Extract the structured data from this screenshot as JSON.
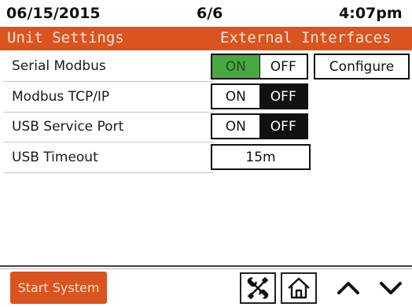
{
  "status": {
    "date": "06/15/2015",
    "page": "6/6",
    "time": "4:07pm"
  },
  "title": {
    "left": "Unit Settings",
    "right": "External Interfaces"
  },
  "rows": [
    {
      "label": "Serial Modbus",
      "on": "ON",
      "off": "OFF",
      "state": "on",
      "configure": "Configure"
    },
    {
      "label": "Modbus TCP/IP",
      "on": "ON",
      "off": "OFF",
      "state": "off"
    },
    {
      "label": "USB Service Port",
      "on": "ON",
      "off": "OFF",
      "state": "off"
    },
    {
      "label": "USB Timeout",
      "value": "15m"
    }
  ],
  "footer": {
    "start": "Start System"
  },
  "icons": {
    "tools": "tools-icon",
    "home": "home-icon",
    "up": "chevron-up-icon",
    "down": "chevron-down-icon"
  },
  "colors": {
    "accent": "#d9541e",
    "on_active": "#49a841",
    "off_active": "#111111"
  }
}
